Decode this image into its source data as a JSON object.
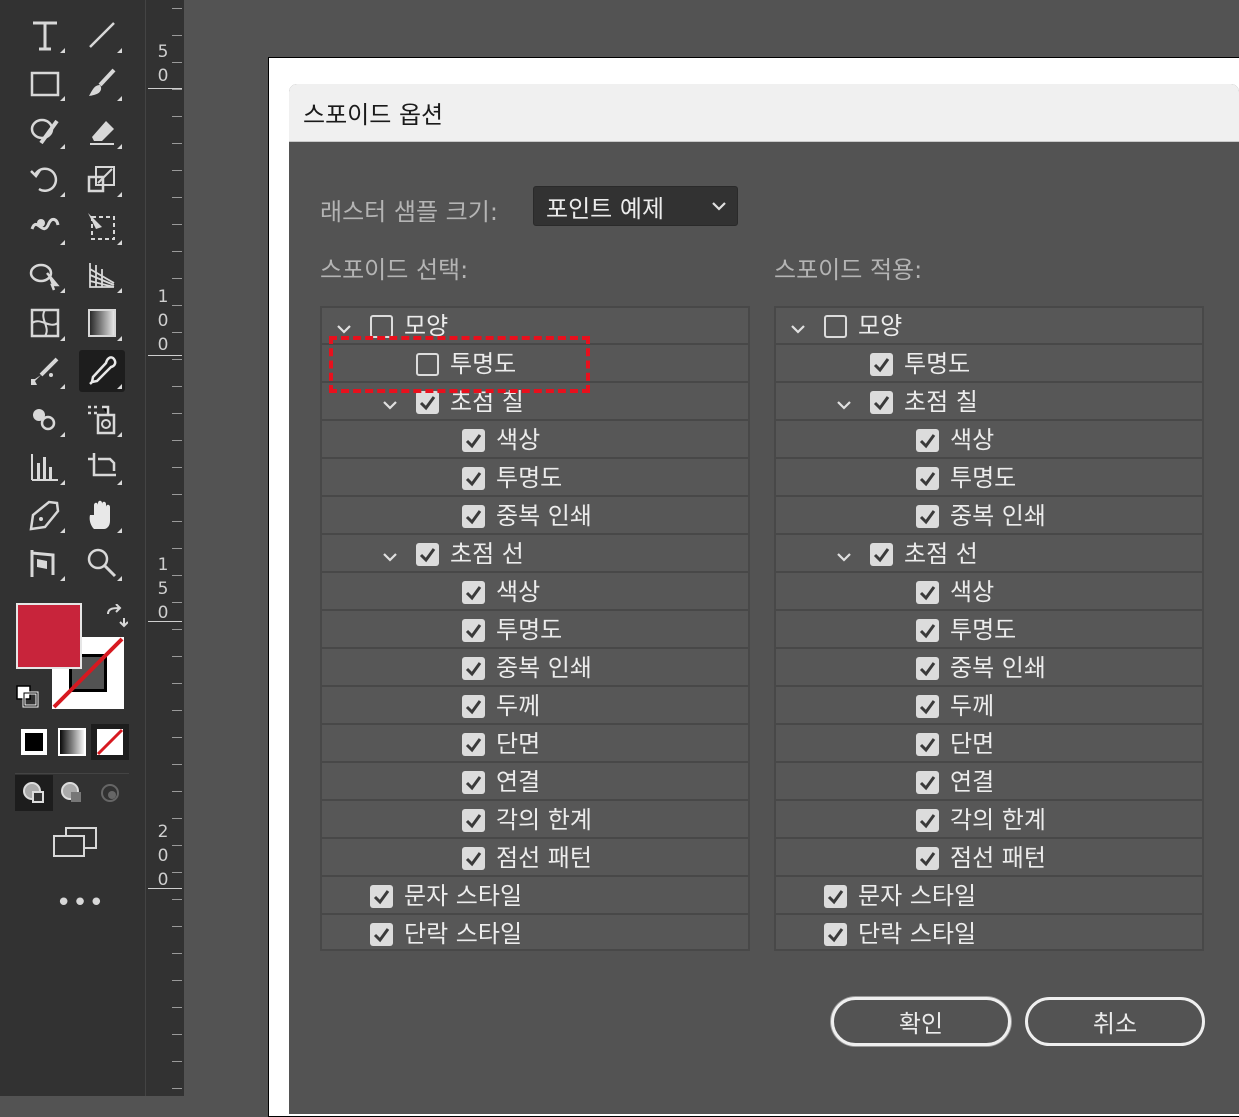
{
  "ruler": {
    "marks": [
      {
        "d1": "5",
        "d2": "0"
      },
      {
        "d1": "1",
        "d2": "0",
        "d3": "0"
      },
      {
        "d1": "1",
        "d2": "5",
        "d3": "0"
      },
      {
        "d1": "2",
        "d2": "0",
        "d3": "0"
      }
    ]
  },
  "toolbar": {
    "tools": [
      "type-tool-icon",
      "line-tool-icon",
      "rectangle-tool-icon",
      "paintbrush-tool-icon",
      "shaper-tool-icon",
      "eraser-tool-icon",
      "rotate-tool-icon",
      "scale-tool-icon",
      "warp-tool-icon",
      "free-transform-tool-icon",
      "shape-builder-tool-icon",
      "perspective-grid-tool-icon",
      "mesh-tool-icon",
      "gradient-tool-icon",
      "blend-tool-icon",
      "eyedropper-tool-icon",
      "symbol-sprayer-tool-icon",
      "live-paint-tool-icon",
      "column-graph-tool-icon",
      "artboard-tool-icon",
      "pen-tool-icon",
      "hand-tool-icon",
      "puppet-warp-tool-icon",
      "zoom-tool-icon"
    ],
    "fill_color": "#c8243b",
    "more_tools": "•••"
  },
  "dialog": {
    "title": "스포이드 옵션",
    "raster_label": "래스터 샘플 크기:",
    "raster_value": "포인트 예제",
    "pick_label": "스포이드 선택:",
    "apply_label": "스포이드 적용:",
    "ok": "확인",
    "cancel": "취소",
    "pick_rows": [
      {
        "label": "모양",
        "checked": false,
        "indent": 0,
        "arrow": true
      },
      {
        "label": "투명도",
        "checked": false,
        "indent": 1,
        "arrow": false
      },
      {
        "label": "초점 칠",
        "checked": true,
        "indent": 1,
        "arrow": true
      },
      {
        "label": "색상",
        "checked": true,
        "indent": 2,
        "arrow": false
      },
      {
        "label": "투명도",
        "checked": true,
        "indent": 2,
        "arrow": false
      },
      {
        "label": "중복 인쇄",
        "checked": true,
        "indent": 2,
        "arrow": false
      },
      {
        "label": "초점 선",
        "checked": true,
        "indent": 1,
        "arrow": true
      },
      {
        "label": "색상",
        "checked": true,
        "indent": 2,
        "arrow": false
      },
      {
        "label": "투명도",
        "checked": true,
        "indent": 2,
        "arrow": false
      },
      {
        "label": "중복 인쇄",
        "checked": true,
        "indent": 2,
        "arrow": false
      },
      {
        "label": "두께",
        "checked": true,
        "indent": 2,
        "arrow": false
      },
      {
        "label": "단면",
        "checked": true,
        "indent": 2,
        "arrow": false
      },
      {
        "label": "연결",
        "checked": true,
        "indent": 2,
        "arrow": false
      },
      {
        "label": "각의 한계",
        "checked": true,
        "indent": 2,
        "arrow": false
      },
      {
        "label": "점선 패턴",
        "checked": true,
        "indent": 2,
        "arrow": false
      },
      {
        "label": "문자 스타일",
        "checked": true,
        "indent": 0,
        "arrow": false
      },
      {
        "label": "단락 스타일",
        "checked": true,
        "indent": 0,
        "arrow": false
      }
    ],
    "apply_rows": [
      {
        "label": "모양",
        "checked": false,
        "indent": 0,
        "arrow": true
      },
      {
        "label": "투명도",
        "checked": true,
        "indent": 1,
        "arrow": false
      },
      {
        "label": "초점 칠",
        "checked": true,
        "indent": 1,
        "arrow": true
      },
      {
        "label": "색상",
        "checked": true,
        "indent": 2,
        "arrow": false
      },
      {
        "label": "투명도",
        "checked": true,
        "indent": 2,
        "arrow": false
      },
      {
        "label": "중복 인쇄",
        "checked": true,
        "indent": 2,
        "arrow": false
      },
      {
        "label": "초점 선",
        "checked": true,
        "indent": 1,
        "arrow": true
      },
      {
        "label": "색상",
        "checked": true,
        "indent": 2,
        "arrow": false
      },
      {
        "label": "투명도",
        "checked": true,
        "indent": 2,
        "arrow": false
      },
      {
        "label": "중복 인쇄",
        "checked": true,
        "indent": 2,
        "arrow": false
      },
      {
        "label": "두께",
        "checked": true,
        "indent": 2,
        "arrow": false
      },
      {
        "label": "단면",
        "checked": true,
        "indent": 2,
        "arrow": false
      },
      {
        "label": "연결",
        "checked": true,
        "indent": 2,
        "arrow": false
      },
      {
        "label": "각의 한계",
        "checked": true,
        "indent": 2,
        "arrow": false
      },
      {
        "label": "점선 패턴",
        "checked": true,
        "indent": 2,
        "arrow": false
      },
      {
        "label": "문자 스타일",
        "checked": true,
        "indent": 0,
        "arrow": false
      },
      {
        "label": "단락 스타일",
        "checked": true,
        "indent": 0,
        "arrow": false
      }
    ]
  }
}
